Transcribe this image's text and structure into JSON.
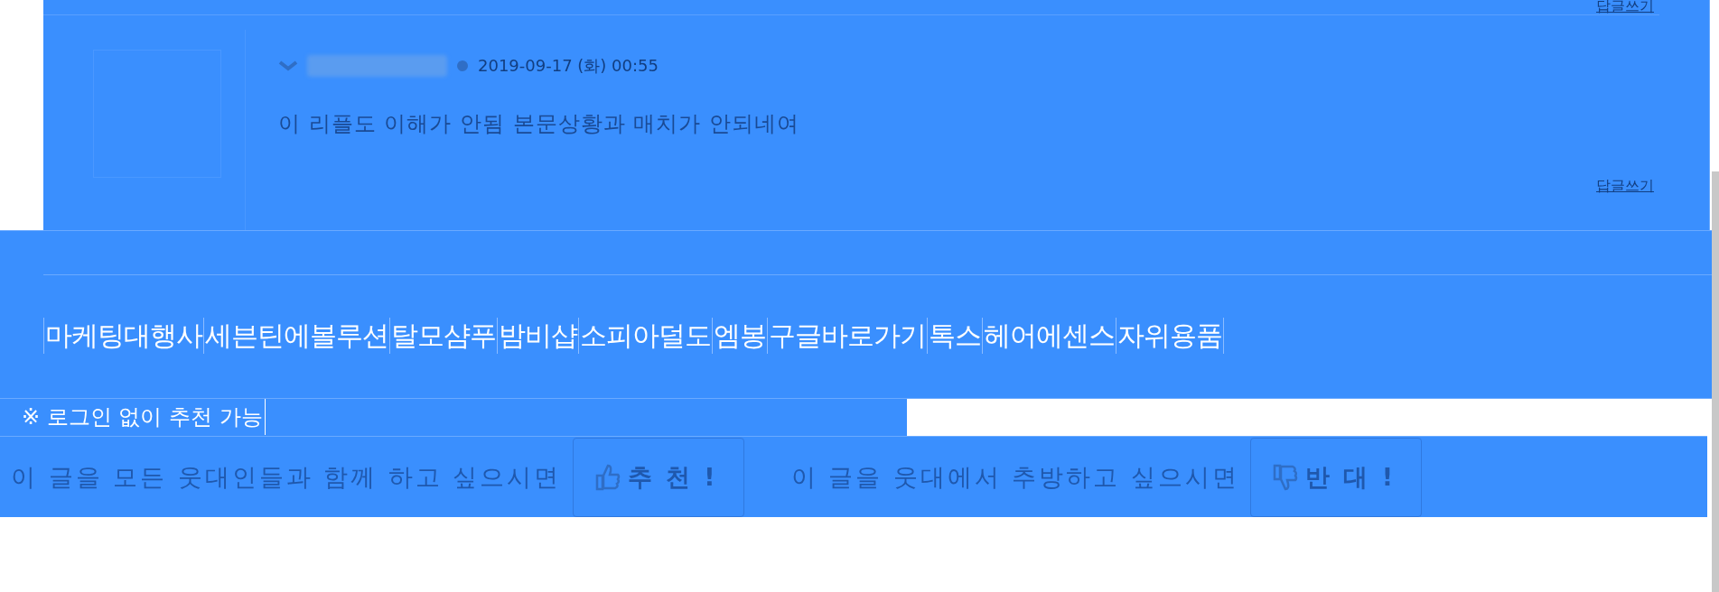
{
  "comments": [
    {
      "reply_link": "답글쓰기",
      "date": "2019-09-17 (화) 00:55",
      "text": "이 리플도 이해가 안됨 본문상황과 매치가 안되네여",
      "reply_link_2": "답글쓰기"
    }
  ],
  "links": [
    "마케팅대행사",
    "세븐틴에볼루션",
    "탈모샴푸",
    "밤비샵",
    "소피아덜도",
    "엠봉",
    "구글바로가기",
    "톡스",
    "헤어에센스",
    "자위용품"
  ],
  "notice": "※ 로그인 없이 추천 가능",
  "vote": {
    "recommend_prompt": "이 글을 모든 웃대인들과 함께 하고 싶으시면",
    "recommend_button": "추 천 !",
    "oppose_prompt": "이 글을 웃대에서 추방하고 싶으시면",
    "oppose_button": "반 대 !"
  }
}
